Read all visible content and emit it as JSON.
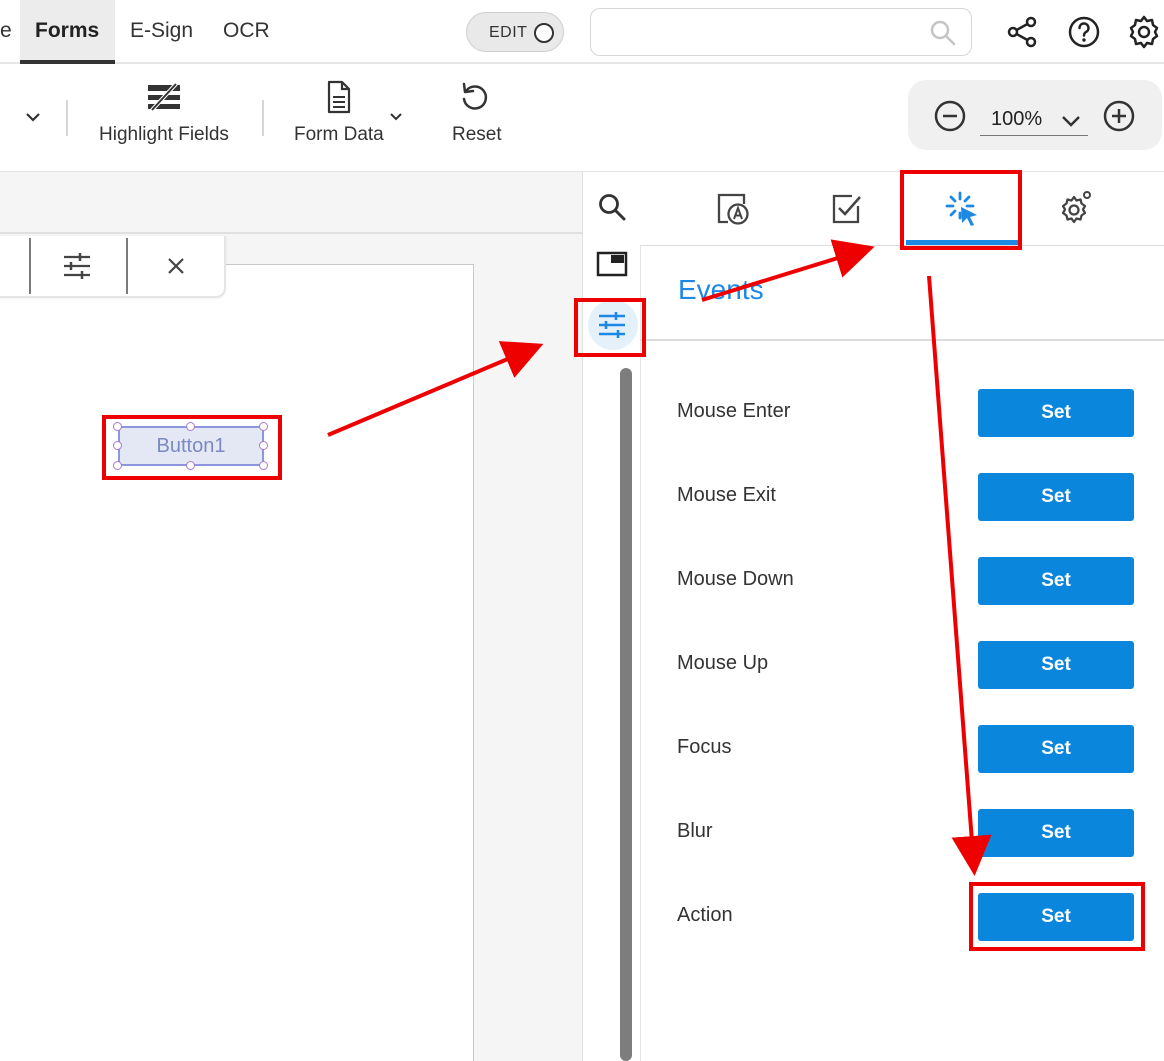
{
  "tabs": [
    {
      "label": "e"
    },
    {
      "label": "Forms"
    },
    {
      "label": "E-Sign"
    },
    {
      "label": "OCR"
    }
  ],
  "edit_toggle": {
    "label": "EDIT"
  },
  "search": {
    "placeholder": "",
    "value": ""
  },
  "toolbar": {
    "highlight_fields_label": "Highlight Fields",
    "form_data_label": "Form Data",
    "reset_label": "Reset"
  },
  "zoom": {
    "value": "100%"
  },
  "form_field": {
    "label": "Button1"
  },
  "panel": {
    "title": "Events",
    "active_tab": "events",
    "events": [
      {
        "label": "Mouse Enter",
        "button": "Set"
      },
      {
        "label": "Mouse Exit",
        "button": "Set"
      },
      {
        "label": "Mouse Down",
        "button": "Set"
      },
      {
        "label": "Mouse Up",
        "button": "Set"
      },
      {
        "label": "Focus",
        "button": "Set"
      },
      {
        "label": "Blur",
        "button": "Set"
      },
      {
        "label": "Action",
        "button": "Set"
      }
    ]
  },
  "colors": {
    "accent": "#1e88e5",
    "set_button": "#0a87dc",
    "annotation": "#ee0000"
  }
}
